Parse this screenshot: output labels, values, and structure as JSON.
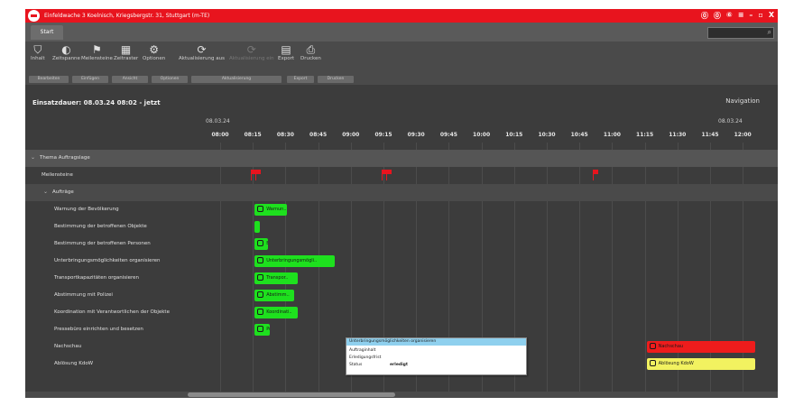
{
  "titlebar": {
    "title": "Einfeldwache 3 Koelnisch, Kriegsbergstr. 31, Stuttgart (m-TE)",
    "controls": [
      "⓪",
      "⓪",
      "⑥",
      "≡",
      "–",
      "▫",
      "X"
    ]
  },
  "tabs": {
    "start": "Start"
  },
  "ribbon": {
    "buttons": [
      {
        "label": "Inhalt",
        "icon": "filter-icon",
        "glyph": "⛉",
        "enabled": true
      },
      {
        "label": "Zeitspanne",
        "icon": "half-circle-icon",
        "glyph": "◐",
        "enabled": true
      },
      {
        "label": "Meilensteine",
        "icon": "milestone-icon",
        "glyph": "⚑",
        "enabled": true
      },
      {
        "label": "Zeitraster",
        "icon": "calendar-icon",
        "glyph": "▦",
        "enabled": true
      },
      {
        "label": "Optionen",
        "icon": "options-icon",
        "glyph": "⚙",
        "enabled": true
      },
      {
        "label": "Aktualisierung aus",
        "icon": "refresh-icon",
        "glyph": "⟳",
        "enabled": true
      },
      {
        "label": "Aktualisierung ein",
        "icon": "refresh-disabled-icon",
        "glyph": "⟳",
        "enabled": false
      },
      {
        "label": "Export",
        "icon": "export-icon",
        "glyph": "▤",
        "enabled": true
      },
      {
        "label": "Drucken",
        "icon": "print-icon",
        "glyph": "⎙",
        "enabled": true
      }
    ],
    "groups": [
      "Bearbeiten",
      "Einfügen",
      "Ansicht",
      "Optionen",
      "Aktualisierung",
      "Export",
      "Drucken"
    ]
  },
  "header": {
    "einsatzdauer": "Einsatzdauer: 08.03.24 08:02 - jetzt",
    "navigation": "Navigation"
  },
  "timeline": {
    "date_left": "08.03.24",
    "date_right": "08.03.24",
    "times": [
      "08:00",
      "08:15",
      "08:30",
      "08:45",
      "09:00",
      "09:15",
      "09:30",
      "09:45",
      "10:00",
      "10:15",
      "10:30",
      "10:45",
      "11:00",
      "11:15",
      "11:30",
      "11:45",
      "12:00"
    ]
  },
  "rows": {
    "section_label": "Thema Auftragslage",
    "meilensteine": "Meilensteine",
    "auftraege": "Aufträge",
    "tasks": [
      {
        "label": "Warnung der Bevölkerung",
        "bar_text": "Warnun..",
        "start": "08:15",
        "end": "08:30",
        "color": "green"
      },
      {
        "label": "Bestimmung der betroffenen Objekte",
        "bar_text": "",
        "start": "08:15",
        "end": "08:16",
        "color": "green"
      },
      {
        "label": "Bestimmung der betroffenen Personen",
        "bar_text": "B..",
        "start": "08:15",
        "end": "08:21",
        "color": "green"
      },
      {
        "label": "Unterbringungsmöglichkeiten organisieren",
        "bar_text": "Unterbringungsmögli..",
        "start": "08:15",
        "end": "08:52",
        "color": "green"
      },
      {
        "label": "Transportkapazitäten organisieren",
        "bar_text": "Transpor..",
        "start": "08:15",
        "end": "08:35",
        "color": "green"
      },
      {
        "label": "Abstimmung mit Polizei",
        "bar_text": "Abstimm..",
        "start": "08:15",
        "end": "08:33",
        "color": "green"
      },
      {
        "label": "Koordination mit Verantwortlichen der Objekte",
        "bar_text": "Koordinati..",
        "start": "08:15",
        "end": "08:35",
        "color": "green"
      },
      {
        "label": "Pressebüro einrichten und besetzen",
        "bar_text": "Pr..",
        "start": "08:15",
        "end": "08:22",
        "color": "green"
      },
      {
        "label": "Nachschau",
        "bar_text": "Nachschau",
        "start": "11:15",
        "end": "12:05",
        "color": "red"
      },
      {
        "label": "Ablösung KdoW",
        "bar_text": "Ablösung KdoW",
        "start": "11:15",
        "end": "12:05",
        "color": "yellow"
      }
    ]
  },
  "milestones": [
    "08:15",
    "08:17",
    "09:15",
    "09:17",
    "10:52"
  ],
  "tooltip": {
    "title": "Unterbringungsmöglichkeiten organisieren",
    "line1": "Auftraginhalt",
    "line2": "Erledigungsfrist",
    "status_label": "Status",
    "status_value": "erledigt"
  },
  "colors": {
    "accent_red": "#e8141e",
    "bar_green": "#1ee01e",
    "bar_red": "#ee1c1c",
    "bar_yellow": "#f2f260"
  }
}
